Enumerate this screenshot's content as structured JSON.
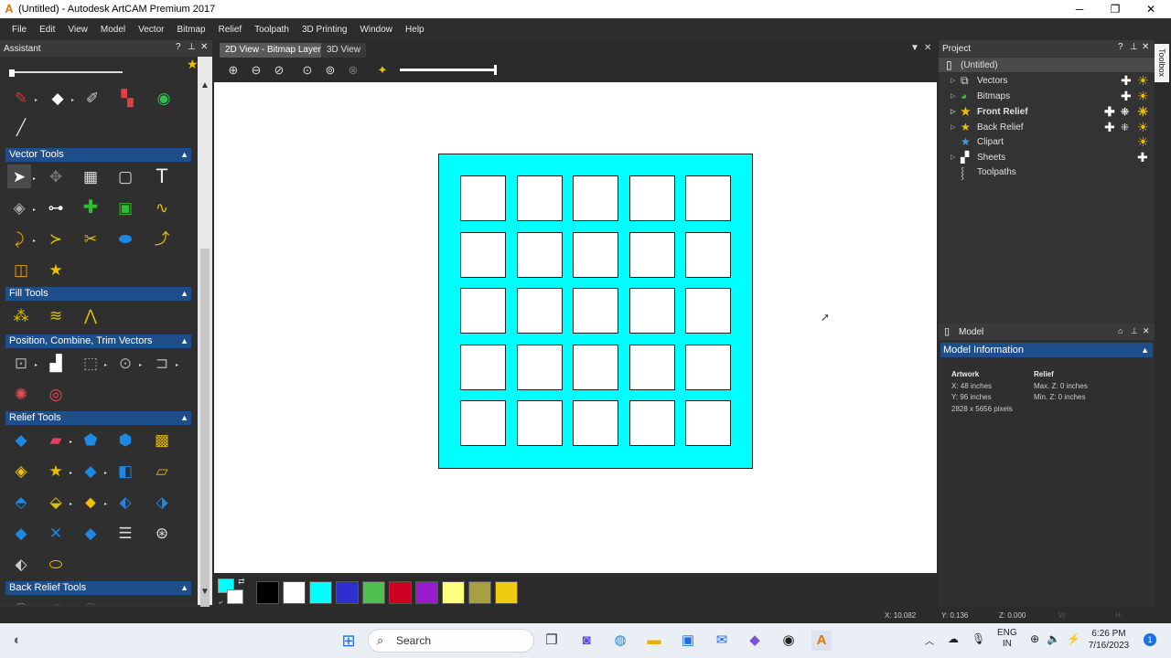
{
  "window": {
    "title": "(Untitled) - Autodesk ArtCAM Premium 2017",
    "controls": {
      "minimize": "─",
      "restore": "❐",
      "close": "✕"
    }
  },
  "menu": [
    "File",
    "Edit",
    "View",
    "Model",
    "Vector",
    "Bitmap",
    "Relief",
    "Toolpath",
    "3D Printing",
    "Window",
    "Help"
  ],
  "assistant": {
    "title": "Assistant",
    "controls": {
      "help": "?",
      "pin": "⊥",
      "close": "✕"
    },
    "sections": {
      "vector_tools": "Vector Tools",
      "fill_tools": "Fill Tools",
      "position_tools": "Position, Combine, Trim Vectors",
      "relief_tools": "Relief Tools",
      "back_relief_tools": "Back Relief Tools"
    }
  },
  "tabs": {
    "view2d": "2D View - Bitmap Layer",
    "view3d": "3D View"
  },
  "colors": {
    "accent": "#1f4f8a",
    "canvas_bg": "#ffffff",
    "board_fill": "#00ffff",
    "palette": [
      "#000000",
      "#ffffff",
      "#00ffff",
      "#2f2fd0",
      "#4fc04f",
      "#d00020",
      "#9a1ad0",
      "#ffff80",
      "#a8a040",
      "#f0cc10"
    ]
  },
  "project": {
    "title": "Project",
    "controls": {
      "help": "?",
      "pin": "⊥",
      "close": "✕"
    },
    "items": [
      {
        "label": "(Untitled)",
        "icon": "document-icon"
      },
      {
        "label": "Vectors",
        "icon": "vectors-icon"
      },
      {
        "label": "Bitmaps",
        "icon": "bitmaps-icon"
      },
      {
        "label": "Front Relief",
        "icon": "star-icon"
      },
      {
        "label": "Back Relief",
        "icon": "star-icon"
      },
      {
        "label": "Clipart",
        "icon": "star-blue-icon"
      },
      {
        "label": "Sheets",
        "icon": "sheets-icon"
      },
      {
        "label": "Toolpaths",
        "icon": "toolpaths-icon"
      }
    ],
    "toolbox_tab": "Toolbox"
  },
  "model": {
    "title": "Model",
    "info_title": "Model Information",
    "artwork": {
      "heading": "Artwork",
      "x": "X: 48 inches",
      "y": "Y: 96 inches",
      "pixels": "2828 x 5656 pixels"
    },
    "relief": {
      "heading": "Relief",
      "max_z": "Max. Z: 0 inches",
      "min_z": "Min. Z: 0 inches"
    }
  },
  "status": {
    "x": "X: 10.082",
    "y": "Y: 0.136",
    "z": "Z: 0.000",
    "w": "W:",
    "h": "H:"
  },
  "taskbar": {
    "search_placeholder": "Search",
    "language": "ENG",
    "region": "IN",
    "time": "6:26 PM",
    "date": "7/16/2023",
    "notifications": "1"
  }
}
